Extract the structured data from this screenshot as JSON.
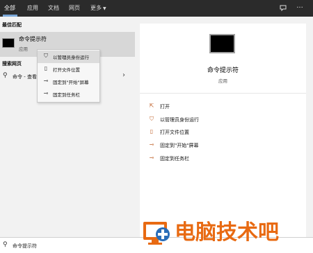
{
  "tabs": [
    {
      "label": "全部",
      "active": true
    },
    {
      "label": "应用"
    },
    {
      "label": "文档"
    },
    {
      "label": "网页"
    },
    {
      "label": "更多"
    }
  ],
  "top_icons": [
    "feedback-icon",
    "more-options-icon"
  ],
  "left": {
    "best_match_label": "最佳匹配",
    "best_match_title": "命令提示符",
    "best_match_subtitle": "应用",
    "web_label": "搜索网页",
    "web_text": "命令 - 查看网络搜索结果"
  },
  "context_menu": [
    {
      "label": "以管理员身份运行",
      "icon": "admin-shield-icon"
    },
    {
      "label": "打开文件位置",
      "icon": "folder-icon"
    },
    {
      "label": "固定到\"开始\"屏幕",
      "icon": "pin-icon"
    },
    {
      "label": "固定到任务栏",
      "icon": "pin-taskbar-icon"
    }
  ],
  "detail": {
    "title": "命令提示符",
    "subtitle": "应用",
    "actions": [
      {
        "label": "打开",
        "icon": "open-icon"
      },
      {
        "label": "以管理员身份运行",
        "icon": "admin-shield-icon"
      },
      {
        "label": "打开文件位置",
        "icon": "folder-icon"
      },
      {
        "label": "固定到\"开始\"屏幕",
        "icon": "pin-icon"
      },
      {
        "label": "固定到任务栏",
        "icon": "pin-taskbar-icon"
      }
    ]
  },
  "search": {
    "value": "命令提示符"
  },
  "watermark": {
    "text": "电脑技术吧"
  },
  "colors": {
    "topbar": "#2b2b2b",
    "accent": "#7aa7d8",
    "action_icon": "#c0622b",
    "watermark": "#e86a12"
  }
}
